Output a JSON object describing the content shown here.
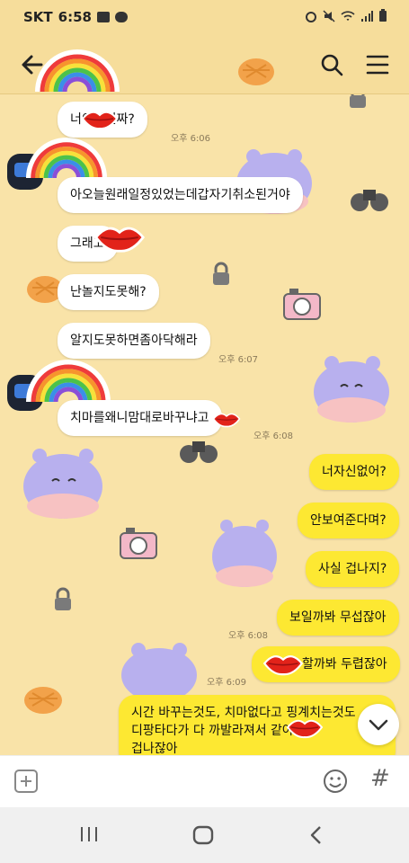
{
  "status_bar": {
    "carrier": "SKT",
    "time": "6:58",
    "icons": [
      "gallery-icon",
      "talk-icon",
      "alarm-icon",
      "mute-icon",
      "wifi-icon",
      "signal-icon",
      "battery-icon"
    ]
  },
  "header": {
    "icons": [
      "back-arrow-icon",
      "search-icon",
      "menu-icon"
    ]
  },
  "messages": [
    {
      "side": "left",
      "text": "너이냐진짜?",
      "time": "오후 6:06"
    },
    {
      "side": "left",
      "text": "아오늘원래일정있었는데갑자기취소된거야",
      "time": ""
    },
    {
      "side": "left",
      "text": "그래고",
      "time": ""
    },
    {
      "side": "left",
      "text": "난놀지도못해?",
      "time": ""
    },
    {
      "side": "left",
      "text": "알지도못하면좀아닥해라",
      "time": "오후 6:07"
    },
    {
      "side": "left",
      "text": "치마를왜니맘대로바꾸냐고",
      "time": "오후 6:08"
    },
    {
      "side": "right",
      "text": "너자신없어?",
      "time": ""
    },
    {
      "side": "right",
      "text": "안보여준다며?",
      "time": ""
    },
    {
      "side": "right",
      "text": "사실 겁나지?",
      "time": ""
    },
    {
      "side": "right",
      "text": "보일까봐 무섭잖아",
      "time": "오후 6:08"
    },
    {
      "side": "right",
      "text": "할까봐 두렵잖아",
      "time": "오후 6:09"
    },
    {
      "side": "right",
      "text_lines": [
        "시간 바꾸는것도, 치마없다고 핑계치는것도",
        "디팡타다가 다 까발라져서 같아서",
        "겁나잖아"
      ],
      "time": ""
    }
  ],
  "input_bar": {
    "icons": [
      "plus-icon",
      "emoji-icon",
      "hash-icon"
    ],
    "hash_label": "#"
  },
  "nav_bar": {
    "icons": [
      "recent-apps-icon",
      "home-icon",
      "back-icon"
    ]
  }
}
